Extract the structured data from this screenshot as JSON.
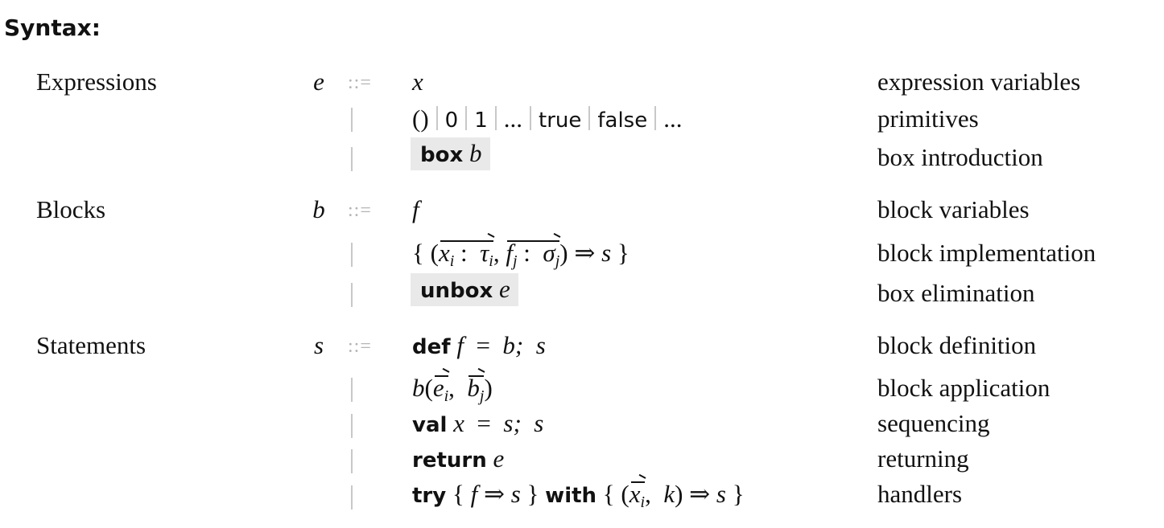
{
  "heading": "Syntax:",
  "grammar": {
    "expressions": {
      "category": "Expressions",
      "metavar": "e",
      "define_op": "::=",
      "alt_op": "|",
      "rules": [
        {
          "description": "expression variables",
          "production": {
            "var": "x"
          }
        },
        {
          "description": "primitives",
          "production": {
            "items": [
              "()",
              "0",
              "1",
              "...",
              "true",
              "false",
              "..."
            ]
          }
        },
        {
          "description": "box introduction",
          "highlighted": true,
          "production": {
            "keyword": "box",
            "arg": "b"
          }
        }
      ]
    },
    "blocks": {
      "category": "Blocks",
      "metavar": "b",
      "define_op": "::=",
      "alt_op": "|",
      "rules": [
        {
          "description": "block variables",
          "production": {
            "var": "f"
          }
        },
        {
          "description": "block implementation",
          "production": {
            "open": "{ (",
            "x": "x",
            "i": "i",
            "colon": ":",
            "tau": "τ",
            "comma": ",",
            "f": "f",
            "j": "j",
            "sigma": "σ",
            "close": ")",
            "arrow": "⇒",
            "body": "s",
            "end": "}"
          }
        },
        {
          "description": "box elimination",
          "highlighted": true,
          "production": {
            "keyword": "unbox",
            "arg": "e"
          }
        }
      ]
    },
    "statements": {
      "category": "Statements",
      "metavar": "s",
      "define_op": "::=",
      "alt_op": "|",
      "rules": [
        {
          "description": "block definition",
          "production": {
            "keyword": "def",
            "name": "f",
            "eq": "=",
            "value": "b;",
            "rest": "s"
          }
        },
        {
          "description": "block application",
          "production": {
            "fn": "b",
            "open": "(",
            "e": "e",
            "i": "i",
            "comma": ",",
            "b": "b",
            "j": "j",
            "close": ")"
          }
        },
        {
          "description": "sequencing",
          "production": {
            "keyword": "val",
            "name": "x",
            "eq": "=",
            "value": "s;",
            "rest": "s"
          }
        },
        {
          "description": "returning",
          "production": {
            "keyword": "return",
            "arg": "e"
          }
        },
        {
          "description": "handlers",
          "production": {
            "kw_try": "try",
            "open1": "{",
            "f": "f",
            "arrow": "⇒",
            "s": "s",
            "close1": "}",
            "kw_with": "with",
            "open2": "{ (",
            "x": "x",
            "i": "i",
            "comma": ",",
            "k": "k",
            "close_paren": ")",
            "close2": "}"
          }
        }
      ]
    }
  }
}
